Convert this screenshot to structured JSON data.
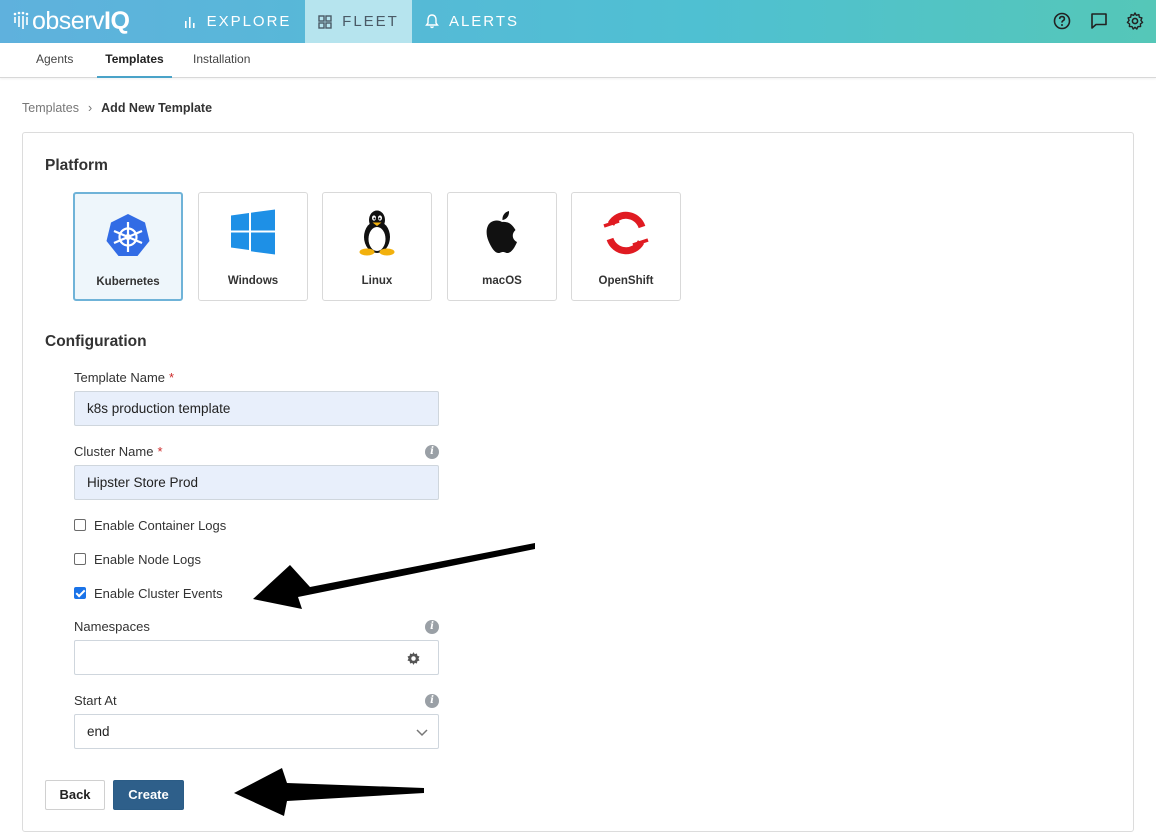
{
  "brand": {
    "logo_text_a": "observ",
    "logo_text_b": "IQ"
  },
  "nav": {
    "items": [
      {
        "label": "EXPLORE",
        "icon": "bar-chart-icon"
      },
      {
        "label": "FLEET",
        "icon": "grid-icon"
      },
      {
        "label": "ALERTS",
        "icon": "bell-icon"
      }
    ],
    "active": "FLEET",
    "right_icons": [
      "help-icon",
      "chat-icon",
      "settings-icon"
    ]
  },
  "subtabs": {
    "items": [
      "Agents",
      "Templates",
      "Installation"
    ],
    "active": "Templates"
  },
  "breadcrumb": {
    "parent": "Templates",
    "separator": "›",
    "current": "Add New Template"
  },
  "platform": {
    "title": "Platform",
    "options": [
      "Kubernetes",
      "Windows",
      "Linux",
      "macOS",
      "OpenShift"
    ],
    "selected": "Kubernetes"
  },
  "configuration": {
    "title": "Configuration",
    "template_name": {
      "label": "Template Name",
      "required_mark": "*",
      "value": "k8s production template"
    },
    "cluster_name": {
      "label": "Cluster Name",
      "required_mark": "*",
      "value": "Hipster Store Prod"
    },
    "checkboxes": [
      {
        "label": "Enable Container Logs",
        "checked": false
      },
      {
        "label": "Enable Node Logs",
        "checked": false
      },
      {
        "label": "Enable Cluster Events",
        "checked": true
      }
    ],
    "namespaces": {
      "label": "Namespaces",
      "value": ""
    },
    "start_at": {
      "label": "Start At",
      "value": "end"
    },
    "info_glyph": "i"
  },
  "actions": {
    "back_label": "Back",
    "create_label": "Create"
  },
  "colors": {
    "accent": "#2e5f8a",
    "nav_gradient_start": "#5fb1dd",
    "nav_gradient_end": "#55c7b8",
    "selected_border": "#6fb3d8",
    "required": "#cc2a2a"
  }
}
